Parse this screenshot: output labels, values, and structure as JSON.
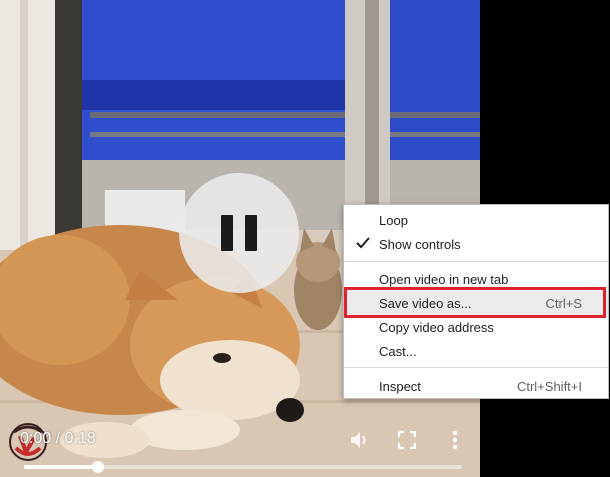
{
  "player": {
    "time_display": "0:00 / 0:18",
    "progress": 0.17,
    "state": "playing",
    "icons": {
      "pause": "pause-icon",
      "volume": "volume-icon",
      "fullscreen": "fullscreen-icon",
      "more": "more-options-icon",
      "watermark": "watermark-logo-icon"
    }
  },
  "context_menu": {
    "items": [
      {
        "label": "Loop",
        "checked": false
      },
      {
        "label": "Show controls",
        "checked": true
      },
      {
        "label": "Open video in new tab"
      },
      {
        "label": "Save video as...",
        "shortcut": "Ctrl+S",
        "highlighted": true
      },
      {
        "label": "Copy video address"
      },
      {
        "label": "Cast..."
      },
      {
        "label": "Inspect",
        "shortcut": "Ctrl+Shift+I"
      }
    ]
  },
  "colors": {
    "highlight_border": "#e0222c",
    "menu_bg": "#ffffff",
    "page_bg": "#000000"
  }
}
